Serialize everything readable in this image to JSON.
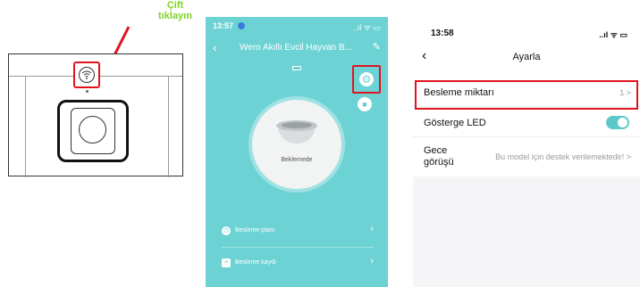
{
  "callout": {
    "line1": "Çift",
    "line2": "tıklayın"
  },
  "device": {
    "button_icon": "wifi-icon"
  },
  "app_main": {
    "status_time": "13:57",
    "status_icons": "..ıl ᯤ ▭",
    "title": "Wero Akıllı Evcil Hayvan B...",
    "feeder_state": "Beklemede",
    "menu": [
      {
        "icon": "clock-icon",
        "label": "Besleme planı"
      },
      {
        "icon": "list-icon",
        "label": "Besleme kaydı"
      }
    ],
    "colors": {
      "background": "#6dd2d4",
      "highlight": "#e0141e"
    }
  },
  "settings": {
    "status_time": "13:58",
    "status_icons": "..ıl ᯤ ▭",
    "title": "Ayarla",
    "rows": [
      {
        "label": "Besleme miktarı",
        "value": "1 >"
      },
      {
        "label": "Gösterge LED",
        "toggle": true
      },
      {
        "label_line1": "Gece",
        "label_line2": "görüşü",
        "value": "Bu model için destek verilemektedir! >"
      }
    ],
    "colors": {
      "toggle": "#5cc8cc"
    }
  }
}
